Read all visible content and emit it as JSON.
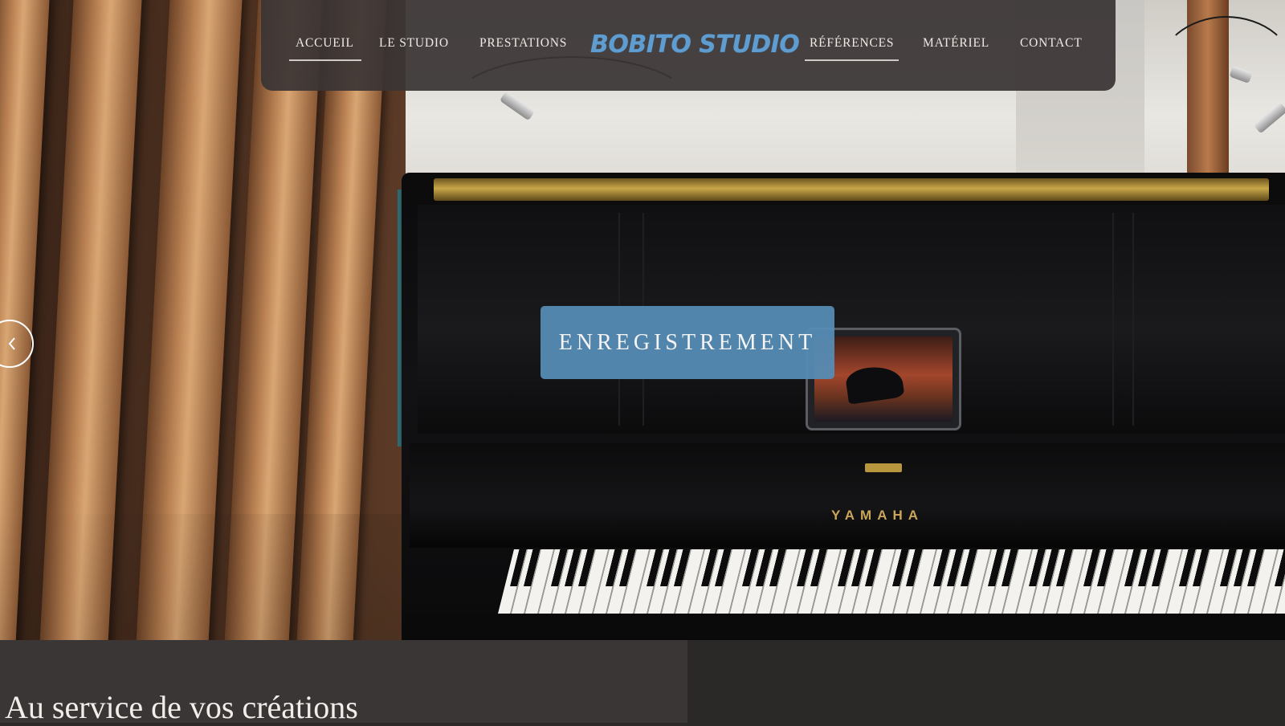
{
  "nav": {
    "items": [
      {
        "label": "ACCUEIL",
        "active": true
      },
      {
        "label": "LE STUDIO"
      },
      {
        "label": "PRESTATIONS"
      },
      {
        "label": "RÉFÉRENCES",
        "active": true
      },
      {
        "label": "MATÉRIEL"
      },
      {
        "label": "CONTACT"
      }
    ],
    "logo_text": "BOBITO STUDIO"
  },
  "hero": {
    "slide_label": "ENREGISTREMENT",
    "piano_brand": "YAMAHA",
    "prev_icon": "chevron-left-icon"
  },
  "section": {
    "title": "Au service de vos créations"
  },
  "colors": {
    "nav_bg": "#3a3535",
    "logo": "#5f9ccf",
    "cta_bg": "#568cb6",
    "bottom_panel": "#3b3636",
    "page_bg": "#2b2828"
  }
}
